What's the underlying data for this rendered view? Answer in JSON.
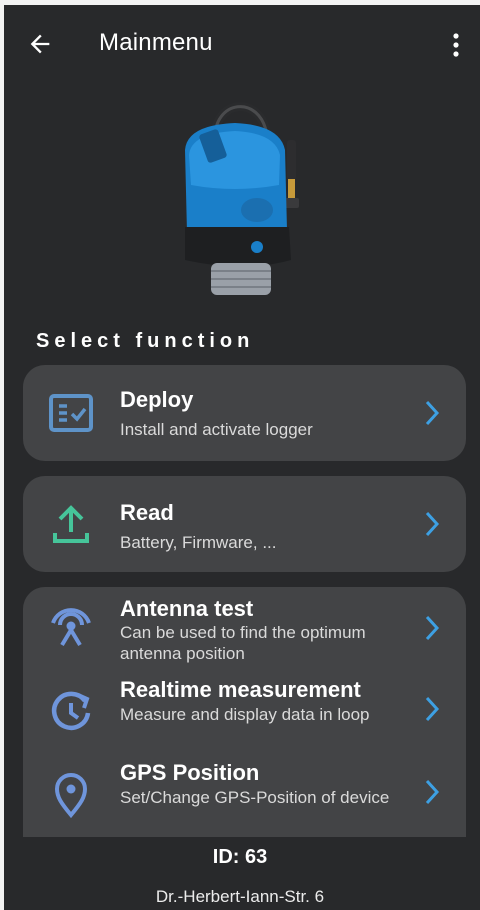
{
  "appbar": {
    "title": "Mainmenu",
    "back_icon": "arrow-left-icon",
    "menu_icon": "more-vert-icon"
  },
  "section_title": "Select function",
  "menu_items": [
    {
      "label": "Deploy",
      "desc": "Install and activate logger",
      "icon": "checklist-icon",
      "icon_color": "#5e93c8"
    },
    {
      "label": "Read",
      "desc": "Battery, Firmware, ...",
      "icon": "upload-icon",
      "icon_color": "#46c59a"
    },
    {
      "label": "Antenna test",
      "desc": "Can be used to find the optimum antenna position",
      "icon": "antenna-icon",
      "icon_color": "#6f95db"
    },
    {
      "label": "Realtime measurement",
      "desc": "Measure and display data in loop",
      "icon": "timer-refresh-icon",
      "icon_color": "#6f95db"
    },
    {
      "label": "GPS Position",
      "desc": "Set/Change GPS-Position of device",
      "icon": "location-pin-icon",
      "icon_color": "#6f95db"
    }
  ],
  "chevron_color": "#3da0e3",
  "footer": {
    "id": "ID: 63",
    "address": "Dr.-Herbert-Iann-Str. 6"
  }
}
